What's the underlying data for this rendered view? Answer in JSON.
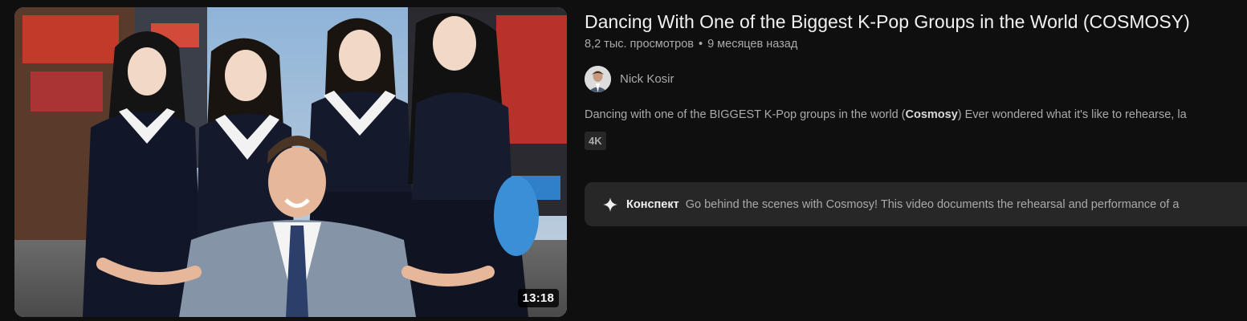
{
  "video": {
    "title": "Dancing With One of the Biggest K-Pop Groups in the World (COSMOSY)",
    "views": "8,2 тыс. просмотров",
    "separator": "•",
    "age": "9 месяцев назад",
    "duration": "13:18",
    "channel": "Nick Kosir",
    "description_prefix": "Dancing with one of the BIGGEST K-Pop groups in the world (",
    "description_bold": "Cosmosy",
    "description_suffix": ") Ever wondered what it's like to rehearse, la",
    "quality_badge": "4K",
    "summary_label": "Конспект",
    "summary_text": "Go behind the scenes with Cosmosy! This video documents the rehearsal and performance of a"
  },
  "colors": {
    "background": "#0f0f0f",
    "primary_text": "#f1f1f1",
    "secondary_text": "#aaaaaa",
    "chip_bg": "#272727"
  },
  "icons": {
    "summary": "sparkle-icon",
    "avatar": "channel-avatar"
  }
}
